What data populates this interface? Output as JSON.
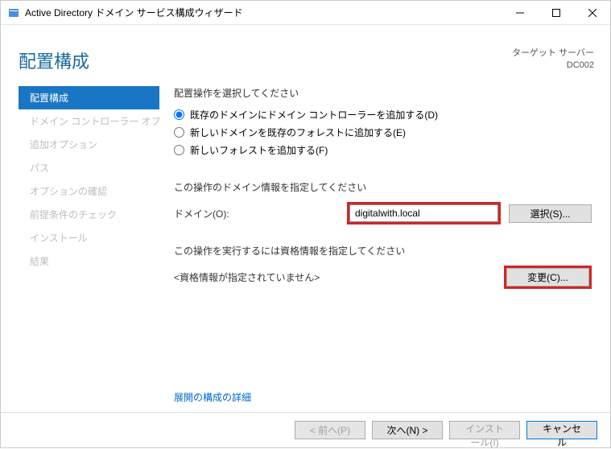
{
  "window": {
    "title": "Active Directory ドメイン サービス構成ウィザード"
  },
  "header": {
    "page_title": "配置構成",
    "target_label": "ターゲット サーバー",
    "target_server": "DC002"
  },
  "sidebar": {
    "items": [
      {
        "label": "配置構成",
        "active": true
      },
      {
        "label": "ドメイン コントローラー オプシ...",
        "active": false
      },
      {
        "label": "追加オプション",
        "active": false
      },
      {
        "label": "パス",
        "active": false
      },
      {
        "label": "オプションの確認",
        "active": false
      },
      {
        "label": "前提条件のチェック",
        "active": false
      },
      {
        "label": "インストール",
        "active": false
      },
      {
        "label": "結果",
        "active": false
      }
    ]
  },
  "body": {
    "select_op_label": "配置操作を選択してください",
    "radio_add_dc": "既存のドメインにドメイン コントローラーを追加する(D)",
    "radio_new_domain": "新しいドメインを既存のフォレストに追加する(E)",
    "radio_new_forest": "新しいフォレストを追加する(F)",
    "domain_info_label": "この操作のドメイン情報を指定してください",
    "domain_field_label": "ドメイン(O):",
    "domain_value": "digitalwith.local",
    "select_button": "選択(S)...",
    "cred_label": "この操作を実行するには資格情報を指定してください",
    "cred_status": "<資格情報が指定されていません>",
    "change_button": "変更(C)...",
    "more_link": "展開の構成の詳細"
  },
  "footer": {
    "prev": "< 前へ(P)",
    "next": "次へ(N) >",
    "install": "インストール(I)",
    "cancel": "キャンセル"
  }
}
